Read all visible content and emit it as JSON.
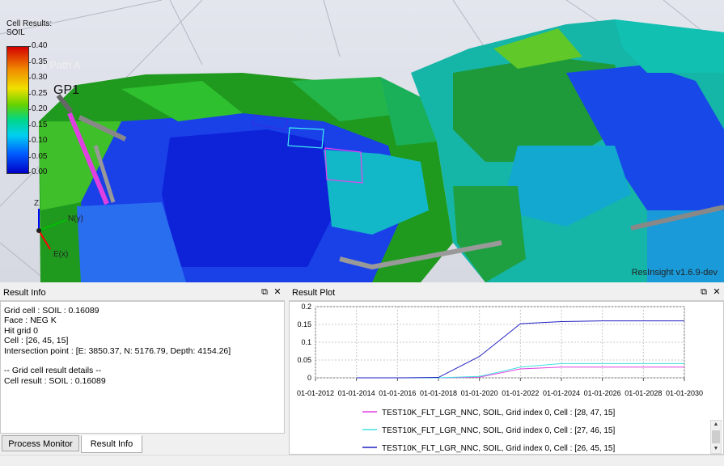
{
  "viewport": {
    "legend_title": "Cell Results:",
    "legend_property": "SOIL",
    "legend_ticks": [
      "0.40",
      "0.35",
      "0.30",
      "0.25",
      "0.20",
      "0.15",
      "0.10",
      "0.05",
      "0.00"
    ],
    "well_label": "GP1",
    "well_path_label": "ll Path A",
    "axis_z": "Z",
    "axis_n": "N(y)",
    "axis_e": "E(x)",
    "version_label": "ResInsight v1.6.9-dev"
  },
  "result_info": {
    "title": "Result Info",
    "float_icon": "float-icon",
    "close_icon": "close-icon",
    "lines": [
      "Grid cell : SOIL : 0.16089",
      "Face : NEG K",
      "Hit grid 0",
      "Cell : [26, 45, 15]",
      "Intersection point : [E: 3850.37, N: 5176.79, Depth: 4154.26]",
      "",
      "-- Grid cell result details --",
      "Cell result : SOIL : 0.16089"
    ]
  },
  "tabs": [
    {
      "label": "Process Monitor",
      "active": false
    },
    {
      "label": "Result Info",
      "active": true
    }
  ],
  "result_plot": {
    "title": "Result Plot",
    "float_icon": "float-icon",
    "close_icon": "close-icon"
  },
  "chart_data": {
    "type": "line",
    "x": [
      "01-01-2012",
      "01-01-2014",
      "01-01-2016",
      "01-01-2018",
      "01-01-2020",
      "01-01-2022",
      "01-01-2024",
      "01-01-2026",
      "01-01-2028",
      "01-01-2030"
    ],
    "y_ticks": [
      "0",
      "0.05",
      "0.1",
      "0.15",
      "0.2"
    ],
    "ylim": [
      0,
      0.2
    ],
    "xlim": [
      2012,
      2030
    ],
    "grid": true,
    "series": [
      {
        "name": "TEST10K_FLT_LGR_NNC, SOIL, Grid index 0, Cell : [28, 47, 15]",
        "color": "#e040e0",
        "points": [
          [
            2014,
            0
          ],
          [
            2016,
            0
          ],
          [
            2018,
            0
          ],
          [
            2020,
            0.002
          ],
          [
            2022,
            0.025
          ],
          [
            2024,
            0.03
          ],
          [
            2026,
            0.03
          ],
          [
            2028,
            0.03
          ],
          [
            2030,
            0.03
          ]
        ]
      },
      {
        "name": "TEST10K_FLT_LGR_NNC, SOIL, Grid index 0, Cell : [27, 46, 15]",
        "color": "#40e0e0",
        "points": [
          [
            2014,
            0
          ],
          [
            2016,
            0
          ],
          [
            2018,
            0
          ],
          [
            2020,
            0.004
          ],
          [
            2022,
            0.03
          ],
          [
            2024,
            0.04
          ],
          [
            2026,
            0.04
          ],
          [
            2028,
            0.04
          ],
          [
            2030,
            0.04
          ]
        ]
      },
      {
        "name": "TEST10K_FLT_LGR_NNC, SOIL, Grid index 0, Cell : [26, 45, 15]",
        "color": "#2020c0",
        "points": [
          [
            2014,
            0
          ],
          [
            2016,
            0
          ],
          [
            2018,
            0.001
          ],
          [
            2020,
            0.06
          ],
          [
            2022,
            0.152
          ],
          [
            2024,
            0.158
          ],
          [
            2026,
            0.16
          ],
          [
            2028,
            0.16
          ],
          [
            2030,
            0.16
          ]
        ]
      }
    ]
  }
}
